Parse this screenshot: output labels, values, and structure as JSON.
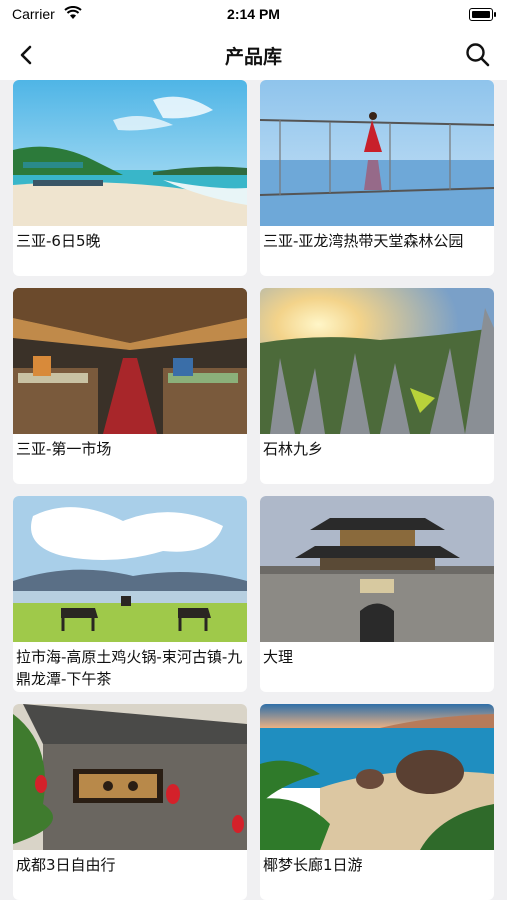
{
  "status": {
    "carrier": "Carrier",
    "time": "2:14 PM"
  },
  "nav": {
    "title": "产品库"
  },
  "products": [
    {
      "name": "三亚-6日5晚"
    },
    {
      "name": "三亚-亚龙湾热带天堂森林公园"
    },
    {
      "name": "三亚-第一市场"
    },
    {
      "name": "石林九乡"
    },
    {
      "name": "拉市海-高原土鸡火锅-束河古镇-九鼎龙潭-下午茶"
    },
    {
      "name": "大理"
    },
    {
      "name": "成都3日自由行"
    },
    {
      "name": "椰梦长廊1日游"
    }
  ],
  "icons": {
    "back": "chevron-left-icon",
    "search": "search-icon",
    "wifi": "wifi-icon",
    "battery": "battery-icon"
  }
}
